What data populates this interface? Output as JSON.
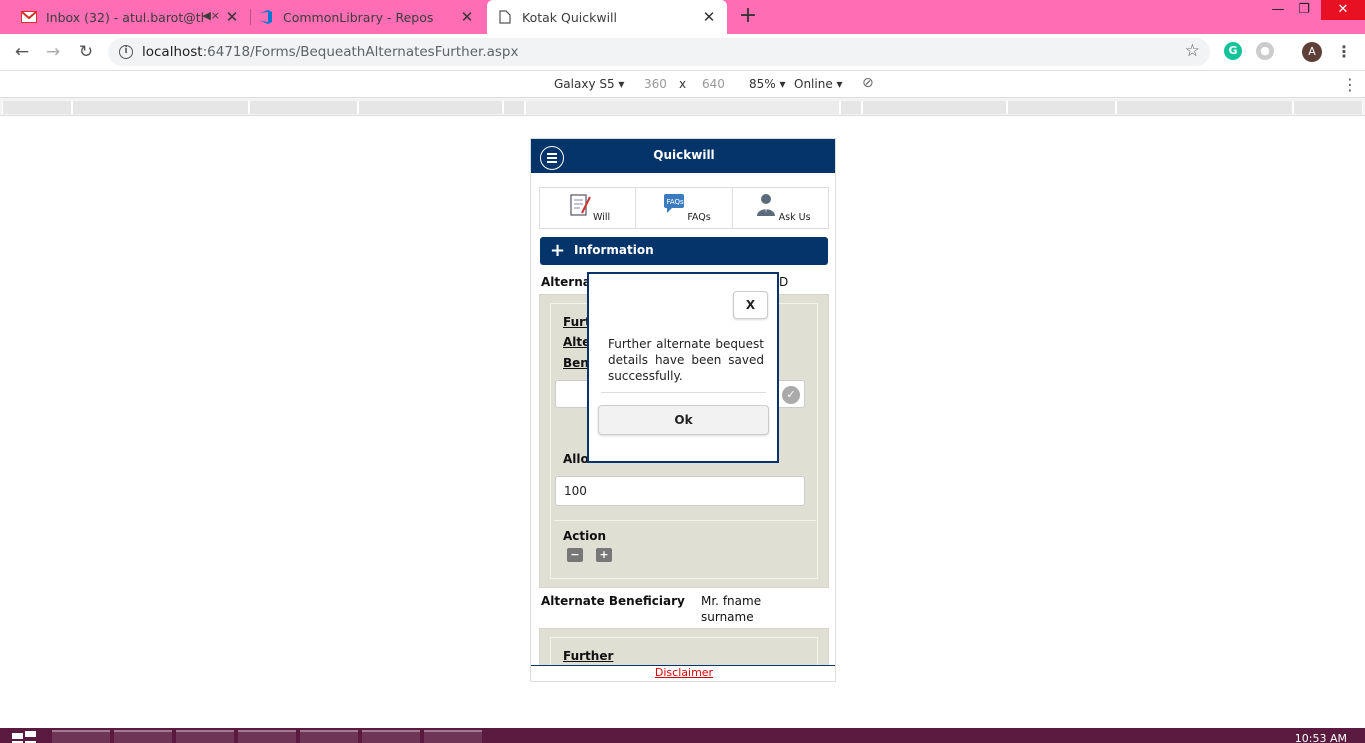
{
  "browser": {
    "tabs": [
      {
        "title": "Inbox (32) - atul.barot@think",
        "icon": "gmail-icon",
        "muted": true
      },
      {
        "title": "CommonLibrary - Repos",
        "icon": "azure-devops-icon"
      },
      {
        "title": "Kotak Quickwill",
        "icon": "page-icon",
        "active": true
      }
    ],
    "url_host": "localhost",
    "url_rest": ":64718/Forms/BequeathAlternatesFurther.aspx",
    "profile_initial": "A"
  },
  "devtools_bar": {
    "device": "Galaxy S5",
    "width": "360",
    "times": "x",
    "height": "640",
    "zoom": "85%",
    "network": "Online"
  },
  "app": {
    "title": "Quickwill",
    "nav": [
      {
        "label": "Will",
        "icon": "will-document-icon"
      },
      {
        "label": "FAQs",
        "icon": "faqs-icon"
      },
      {
        "label": "Ask Us",
        "icon": "ask-us-person-icon"
      }
    ],
    "info_label": "Information",
    "alternate_label_partial": "Alternat",
    "alternate_value_partial": "D",
    "further_link_1": "Furt",
    "further_link_2": "Alte",
    "further_link_3": "Bene",
    "allocation_label_partial": "Allo",
    "allocation_value": "100",
    "action_label": "Action",
    "minus": "−",
    "plus": "+",
    "alt_beneficiary_label": "Alternate Beneficiary",
    "alt_beneficiary_value_1": "Mr. fname",
    "alt_beneficiary_value_2": "surname",
    "further_link_bottom": "Further",
    "disclaimer": "Disclaimer"
  },
  "modal": {
    "close_label": "X",
    "message": "Further alternate bequest details have been saved successfully.",
    "ok_label": "Ok"
  },
  "taskbar": {
    "clock": "10:53 AM"
  }
}
